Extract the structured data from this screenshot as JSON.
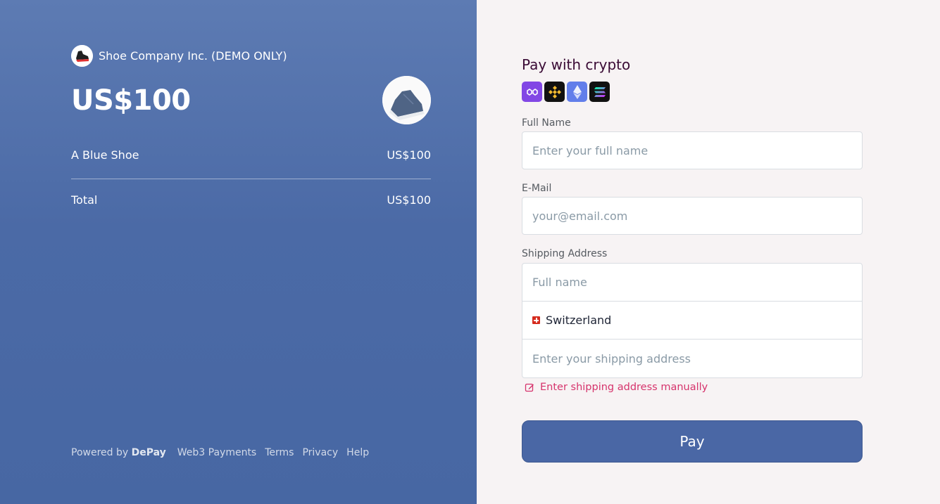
{
  "summary": {
    "company": "Shoe Company Inc. (DEMO ONLY)",
    "big_price": "US$100",
    "item_name": "A Blue Shoe",
    "item_price": "US$100",
    "total_label": "Total",
    "total_price": "US$100"
  },
  "footer": {
    "powered_prefix": "Powered by",
    "powered_brand": "DePay",
    "links": [
      "Web3 Payments",
      "Terms",
      "Privacy",
      "Help"
    ]
  },
  "form": {
    "title": "Pay with crypto",
    "crypto_icons": [
      "polygon-icon",
      "bnb-icon",
      "ethereum-icon",
      "solana-icon"
    ],
    "full_name_label": "Full Name",
    "full_name_placeholder": "Enter your full name",
    "email_label": "E-Mail",
    "email_placeholder": "your@email.com",
    "shipping_label": "Shipping Address",
    "shipping_name_placeholder": "Full name",
    "country": "Switzerland",
    "shipping_address_placeholder": "Enter your shipping address",
    "manual_link": "Enter shipping address manually",
    "pay_button": "Pay"
  },
  "colors": {
    "left_panel": "#4b6aa6",
    "right_panel": "#f7f3f4",
    "title": "#3a0b35",
    "link_accent": "#d6336c",
    "pay_button": "#4a67a5"
  }
}
